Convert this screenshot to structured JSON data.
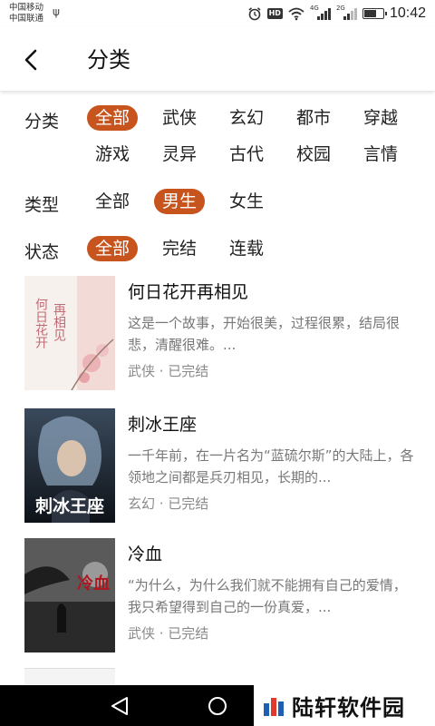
{
  "status_bar": {
    "carrier_1": "中国移动",
    "carrier_2": "中国联通",
    "hd": "HD",
    "net_1": "4G",
    "net_2": "2G",
    "time": "10:42"
  },
  "header": {
    "title": "分类"
  },
  "filters": {
    "category": {
      "label": "分类",
      "options": [
        "全部",
        "武侠",
        "玄幻",
        "都市",
        "穿越",
        "游戏",
        "灵异",
        "古代",
        "校园",
        "言情"
      ],
      "selected": "全部"
    },
    "type": {
      "label": "类型",
      "options": [
        "全部",
        "男生",
        "女生"
      ],
      "selected": "男生"
    },
    "status": {
      "label": "状态",
      "options": [
        "全部",
        "完结",
        "连载"
      ],
      "selected": "全部"
    }
  },
  "books": [
    {
      "title": "何日花开再相见",
      "desc": "这是一个故事，开始很美，过程很累，结局很悲，清醒很难。...",
      "meta": "武侠 · 已完结",
      "cover_text_1": "再相见",
      "cover_text_2": "何日花开"
    },
    {
      "title": "刺冰王座",
      "desc": "一千年前，在一片名为“蓝硫尔斯”的大陆上，各领地之间都是兵刃相见，长期的...",
      "meta": "玄幻 · 已完结",
      "cover_text_1": "刺冰王座"
    },
    {
      "title": "冷血",
      "desc": "“为什么，为什么我们就不能拥有自己的爱情，我只希望得到自己的一份真爱，...",
      "meta": "武侠 · 已完结",
      "cover_text_1": "冷血"
    }
  ],
  "watermark": {
    "text": "陆轩软件园"
  },
  "colors": {
    "accent": "#c8541d"
  }
}
